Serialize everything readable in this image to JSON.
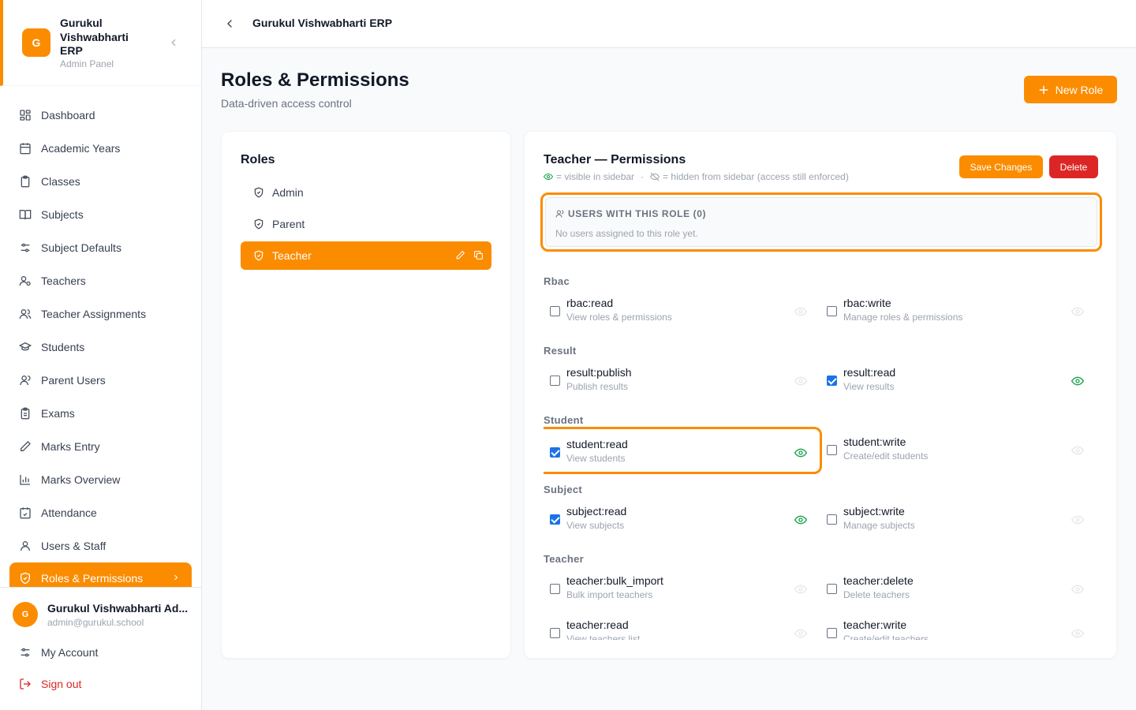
{
  "brand": {
    "logo_letter": "G",
    "name": "Gurukul Vishwabharti ERP",
    "subtitle": "Admin Panel"
  },
  "sidebar": {
    "items": [
      {
        "label": "Dashboard",
        "icon": "dashboard-icon"
      },
      {
        "label": "Academic Years",
        "icon": "calendar-icon"
      },
      {
        "label": "Classes",
        "icon": "clipboard-icon"
      },
      {
        "label": "Subjects",
        "icon": "book-icon"
      },
      {
        "label": "Subject Defaults",
        "icon": "sliders-icon"
      },
      {
        "label": "Teachers",
        "icon": "user-cog-icon"
      },
      {
        "label": "Teacher Assignments",
        "icon": "users-icon"
      },
      {
        "label": "Students",
        "icon": "graduation-cap-icon"
      },
      {
        "label": "Parent Users",
        "icon": "user-icon"
      },
      {
        "label": "Exams",
        "icon": "clipboard-list-icon"
      },
      {
        "label": "Marks Entry",
        "icon": "pen-icon"
      },
      {
        "label": "Marks Overview",
        "icon": "bar-chart-icon"
      },
      {
        "label": "Attendance",
        "icon": "calendar-check-icon"
      },
      {
        "label": "Users & Staff",
        "icon": "user-icon"
      },
      {
        "label": "Roles & Permissions",
        "icon": "shield-check-icon",
        "active": true
      }
    ]
  },
  "user": {
    "avatar_letter": "G",
    "name": "Gurukul Vishwabharti Ad...",
    "email": "admin@gurukul.school",
    "my_account": "My Account",
    "sign_out": "Sign out"
  },
  "topbar": {
    "title": "Gurukul Vishwabharti ERP"
  },
  "page": {
    "title": "Roles & Permissions",
    "subtitle": "Data-driven access control",
    "new_role": "New Role"
  },
  "roles": {
    "title": "Roles",
    "items": [
      {
        "label": "Admin"
      },
      {
        "label": "Parent"
      },
      {
        "label": "Teacher",
        "active": true
      }
    ]
  },
  "permissions": {
    "title": "Teacher — Permissions",
    "legend_visible": "= visible in sidebar",
    "legend_sep": "·",
    "legend_hidden": "= hidden from sidebar (access still enforced)",
    "save": "Save Changes",
    "delete": "Delete",
    "users_heading": "USERS WITH THIS ROLE (0)",
    "users_empty": "No users assigned to this role yet.",
    "groups": [
      {
        "label": "Rbac",
        "perms": [
          {
            "name": "rbac:read",
            "desc": "View roles & permissions",
            "checked": false
          },
          {
            "name": "rbac:write",
            "desc": "Manage roles & permissions",
            "checked": false
          }
        ]
      },
      {
        "label": "Result",
        "perms": [
          {
            "name": "result:publish",
            "desc": "Publish results",
            "checked": false
          },
          {
            "name": "result:read",
            "desc": "View results",
            "checked": true
          }
        ]
      },
      {
        "label": "Student",
        "perms": [
          {
            "name": "student:read",
            "desc": "View students",
            "checked": true
          },
          {
            "name": "student:write",
            "desc": "Create/edit students",
            "checked": false
          }
        ]
      },
      {
        "label": "Subject",
        "perms": [
          {
            "name": "subject:read",
            "desc": "View subjects",
            "checked": true
          },
          {
            "name": "subject:write",
            "desc": "Manage subjects",
            "checked": false
          }
        ]
      },
      {
        "label": "Teacher",
        "perms": [
          {
            "name": "teacher:bulk_import",
            "desc": "Bulk import teachers",
            "checked": false
          },
          {
            "name": "teacher:delete",
            "desc": "Delete teachers",
            "checked": false
          },
          {
            "name": "teacher:read",
            "desc": "View teachers list",
            "checked": false
          },
          {
            "name": "teacher:write",
            "desc": "Create/edit teachers",
            "checked": false
          }
        ]
      }
    ]
  },
  "colors": {
    "accent": "#fb8c00",
    "danger": "#dc2626",
    "eye_visible": "#16a34a",
    "eye_hidden": "#d1d5db"
  }
}
